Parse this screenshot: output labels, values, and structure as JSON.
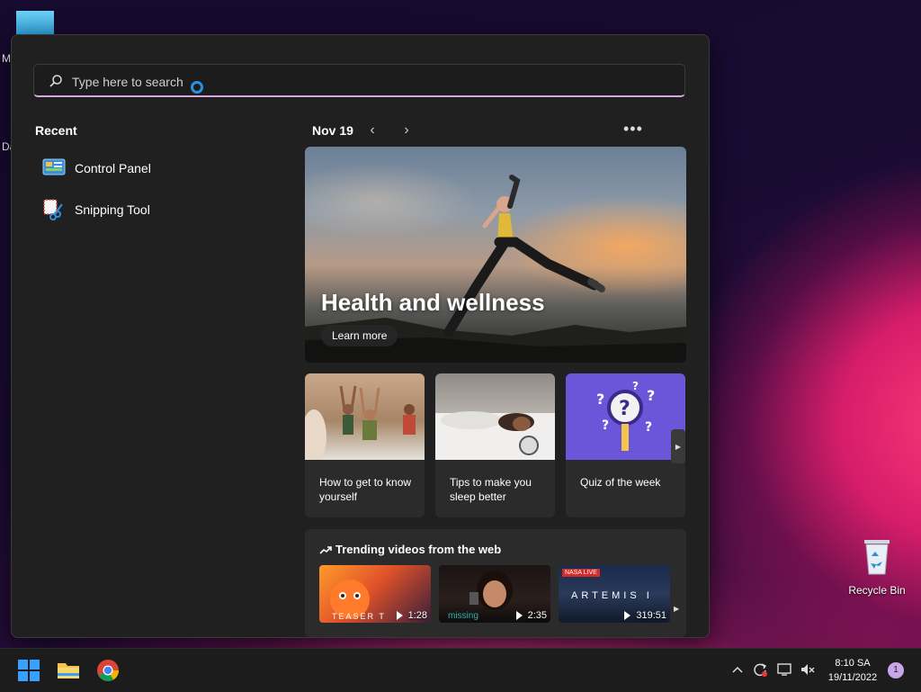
{
  "desktop": {
    "recycle_bin_label": "Recycle Bin",
    "left_edge_letters": [
      "M",
      "Da"
    ]
  },
  "search": {
    "placeholder": "Type here to search"
  },
  "recent": {
    "title": "Recent",
    "items": [
      {
        "label": "Control Panel",
        "icon": "control-panel-icon"
      },
      {
        "label": "Snipping Tool",
        "icon": "snipping-tool-icon"
      }
    ]
  },
  "feed": {
    "date": "Nov 19",
    "prev": "‹",
    "next": "›",
    "more": "•••",
    "hero": {
      "title": "Health and wellness",
      "button": "Learn more"
    },
    "cards": [
      {
        "caption": "How to get to know yourself"
      },
      {
        "caption": "Tips to make you sleep better"
      },
      {
        "caption": "Quiz of the week"
      }
    ]
  },
  "trending": {
    "title": "Trending videos from the web",
    "videos": [
      {
        "duration": "1:28",
        "overlay_text": "TEASER T"
      },
      {
        "duration": "2:35",
        "overlay_text": "missing"
      },
      {
        "duration": "319:51",
        "overlay_text": "ARTEMIS I",
        "badge": "NASA LIVE"
      }
    ]
  },
  "taskbar": {
    "time": "8:10 SA",
    "date": "19/11/2022",
    "notification_count": "1"
  },
  "colors": {
    "accent_blue": "#2b8fe0",
    "start_bg": "#202020",
    "card_bg": "#2b2b2b",
    "search_underline": "#d6a6e0"
  }
}
